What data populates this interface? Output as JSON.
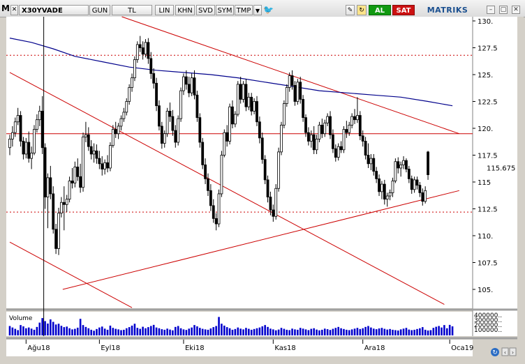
{
  "toolbar": {
    "menu_letter": "M",
    "symbol": "X30YVADE",
    "period": "GUN",
    "currency": "TL",
    "scale_buttons": [
      "LIN",
      "KHN",
      "SVD",
      "SYM",
      "TMP"
    ],
    "buy_label": "AL",
    "sell_label": "SAT",
    "brand": "MATRIKS",
    "brand_color": "#1a4f8f",
    "buy_color": "#119911",
    "sell_color": "#cc1111"
  },
  "chart_data": [
    {
      "type": "candlestick",
      "ylim": [
        103.3,
        130.5
      ],
      "yticks": [
        105,
        107.5,
        110,
        112.5,
        115,
        117.5,
        120,
        122.5,
        125,
        127.5,
        130
      ],
      "ytick_labels": [
        "105.",
        "107.5",
        "110.",
        "112.5",
        "115",
        "117.5",
        "120.",
        "122.5",
        "125.",
        "127.5",
        "130."
      ],
      "last_price_label": "115.675",
      "last_price": 115.675,
      "x_tick_labels": [
        "Ağu18",
        "Eyl18",
        "Eki18",
        "Kas18",
        "Ara18",
        "Oca19"
      ],
      "x_tick_index": [
        6,
        33,
        64,
        97,
        130,
        162
      ],
      "grid": false,
      "moving_average_color": "#00008b",
      "up_color": "#ffffff",
      "down_color": "#000000",
      "candles": [
        [
          118.2,
          119.4,
          117.5,
          119.0
        ],
        [
          119.0,
          120.2,
          118.3,
          119.6
        ],
        [
          119.6,
          121.0,
          119.2,
          120.6
        ],
        [
          120.6,
          121.9,
          120.3,
          121.2
        ],
        [
          121.2,
          121.6,
          118.3,
          118.8
        ],
        [
          118.8,
          119.2,
          117.1,
          117.6
        ],
        [
          117.6,
          119.1,
          117.2,
          118.7
        ],
        [
          118.7,
          119.7,
          116.8,
          117.2
        ],
        [
          117.2,
          118.3,
          116.2,
          117.7
        ],
        [
          117.7,
          120.3,
          117.5,
          119.9
        ],
        [
          119.9,
          121.3,
          119.6,
          120.8
        ],
        [
          120.8,
          122.1,
          120.2,
          121.6
        ],
        [
          121.6,
          123.0,
          117.6,
          118.2
        ],
        [
          118.2,
          118.6,
          112.5,
          113.6
        ],
        [
          113.6,
          115.8,
          110.7,
          115.4
        ],
        [
          115.4,
          116.5,
          113.4,
          113.9
        ],
        [
          113.9,
          114.6,
          110.2,
          110.6
        ],
        [
          110.6,
          111.1,
          108.3,
          108.8
        ],
        [
          108.8,
          112.6,
          108.2,
          112.1
        ],
        [
          112.1,
          113.6,
          111.7,
          113.1
        ],
        [
          113.1,
          114.6,
          110.5,
          112.9
        ],
        [
          112.9,
          113.8,
          112.2,
          113.4
        ],
        [
          113.4,
          115.5,
          113.1,
          115.1
        ],
        [
          115.1,
          116.3,
          114.4,
          114.9
        ],
        [
          114.9,
          116.9,
          114.5,
          116.4
        ],
        [
          116.4,
          117.2,
          115.1,
          115.5
        ],
        [
          115.5,
          116.7,
          114.0,
          114.5
        ],
        [
          114.5,
          119.6,
          114.1,
          119.2
        ],
        [
          119.2,
          120.6,
          118.7,
          119.4
        ],
        [
          119.4,
          120.1,
          117.9,
          118.3
        ],
        [
          118.3,
          118.9,
          117.1,
          117.6
        ],
        [
          117.6,
          118.6,
          116.8,
          117.9
        ],
        [
          117.9,
          118.5,
          116.7,
          117.2
        ],
        [
          117.2,
          117.9,
          116.2,
          116.7
        ],
        [
          116.7,
          117.4,
          115.6,
          116.2
        ],
        [
          116.2,
          117.1,
          115.7,
          116.8
        ],
        [
          116.8,
          117.5,
          115.9,
          116.3
        ],
        [
          116.3,
          118.7,
          116.0,
          118.4
        ],
        [
          118.4,
          120.3,
          118.2,
          119.9
        ],
        [
          119.9,
          120.6,
          119.1,
          119.5
        ],
        [
          119.5,
          120.5,
          119.0,
          120.2
        ],
        [
          120.2,
          121.2,
          119.8,
          120.9
        ],
        [
          120.9,
          121.9,
          120.6,
          121.5
        ],
        [
          121.5,
          122.8,
          121.2,
          122.5
        ],
        [
          122.5,
          124.1,
          122.2,
          123.8
        ],
        [
          123.8,
          125.1,
          123.4,
          124.7
        ],
        [
          124.7,
          126.7,
          124.4,
          126.4
        ],
        [
          126.4,
          128.1,
          126.1,
          127.8
        ],
        [
          127.8,
          128.6,
          127.1,
          127.5
        ],
        [
          127.5,
          128.1,
          126.4,
          126.9
        ],
        [
          126.9,
          128.3,
          126.6,
          128.0
        ],
        [
          128.0,
          128.4,
          126.0,
          126.5
        ],
        [
          126.5,
          127.1,
          124.6,
          125.1
        ],
        [
          125.1,
          125.6,
          123.7,
          124.2
        ],
        [
          124.2,
          124.7,
          121.6,
          122.1
        ],
        [
          122.1,
          122.6,
          119.8,
          120.2
        ],
        [
          120.2,
          120.6,
          118.1,
          118.6
        ],
        [
          118.6,
          119.8,
          118.2,
          119.5
        ],
        [
          119.5,
          121.9,
          119.2,
          121.6
        ],
        [
          121.6,
          122.4,
          120.6,
          121.1
        ],
        [
          121.1,
          121.7,
          119.3,
          119.8
        ],
        [
          119.8,
          120.3,
          118.2,
          118.7
        ],
        [
          118.7,
          121.2,
          118.4,
          120.9
        ],
        [
          120.9,
          123.8,
          120.6,
          123.5
        ],
        [
          123.5,
          125.1,
          123.1,
          124.8
        ],
        [
          124.8,
          125.4,
          123.6,
          124.1
        ],
        [
          124.1,
          124.8,
          122.9,
          123.3
        ],
        [
          123.3,
          125.1,
          123.0,
          124.7
        ],
        [
          124.7,
          125.4,
          122.7,
          123.1
        ],
        [
          123.1,
          123.5,
          120.6,
          121.0
        ],
        [
          121.0,
          121.4,
          118.2,
          118.7
        ],
        [
          118.7,
          119.1,
          116.2,
          116.6
        ],
        [
          116.6,
          117.2,
          114.8,
          115.3
        ],
        [
          115.3,
          115.8,
          113.7,
          114.2
        ],
        [
          114.2,
          114.8,
          112.3,
          112.8
        ],
        [
          112.8,
          113.4,
          111.2,
          111.6
        ],
        [
          111.6,
          112.1,
          110.5,
          111.1
        ],
        [
          111.1,
          114.3,
          110.8,
          113.9
        ],
        [
          113.9,
          117.9,
          113.6,
          117.5
        ],
        [
          117.5,
          119.9,
          117.3,
          119.6
        ],
        [
          119.6,
          120.3,
          118.3,
          118.8
        ],
        [
          118.8,
          122.3,
          118.5,
          122.0
        ],
        [
          122.0,
          122.6,
          120.0,
          120.4
        ],
        [
          120.4,
          121.6,
          120.1,
          121.3
        ],
        [
          121.3,
          124.4,
          121.1,
          124.1
        ],
        [
          124.1,
          124.8,
          122.3,
          122.7
        ],
        [
          122.7,
          124.4,
          122.4,
          124.1
        ],
        [
          124.1,
          124.6,
          121.6,
          122.0
        ],
        [
          122.0,
          123.3,
          121.7,
          122.9
        ],
        [
          122.9,
          123.3,
          121.2,
          121.6
        ],
        [
          121.6,
          122.8,
          121.3,
          122.5
        ],
        [
          122.5,
          123.0,
          120.2,
          120.6
        ],
        [
          120.6,
          121.1,
          118.6,
          119.1
        ],
        [
          119.1,
          119.6,
          116.7,
          117.1
        ],
        [
          117.1,
          117.5,
          114.8,
          115.2
        ],
        [
          115.2,
          115.6,
          113.1,
          113.6
        ],
        [
          113.6,
          114.1,
          111.9,
          112.4
        ],
        [
          112.4,
          112.9,
          111.3,
          111.8
        ],
        [
          111.8,
          114.8,
          111.5,
          114.4
        ],
        [
          114.4,
          118.2,
          114.1,
          117.8
        ],
        [
          117.8,
          120.6,
          117.5,
          120.3
        ],
        [
          120.3,
          122.6,
          120.0,
          122.3
        ],
        [
          122.3,
          124.1,
          122.0,
          123.8
        ],
        [
          123.8,
          125.2,
          123.4,
          124.9
        ],
        [
          124.9,
          125.4,
          123.6,
          124.0
        ],
        [
          124.0,
          124.4,
          122.1,
          122.5
        ],
        [
          122.5,
          124.6,
          122.2,
          124.3
        ],
        [
          124.3,
          124.8,
          122.3,
          122.7
        ],
        [
          122.7,
          123.1,
          120.6,
          121.0
        ],
        [
          121.0,
          121.3,
          119.2,
          119.6
        ],
        [
          119.6,
          120.1,
          118.4,
          118.8
        ],
        [
          118.8,
          119.8,
          118.2,
          119.4
        ],
        [
          119.4,
          120.2,
          117.6,
          118.0
        ],
        [
          118.0,
          119.4,
          117.6,
          119.0
        ],
        [
          119.0,
          120.6,
          118.7,
          120.3
        ],
        [
          120.3,
          120.9,
          119.1,
          119.5
        ],
        [
          119.5,
          120.8,
          119.2,
          120.5
        ],
        [
          120.5,
          121.4,
          120.2,
          121.1
        ],
        [
          121.1,
          121.6,
          119.0,
          119.4
        ],
        [
          119.4,
          119.9,
          117.7,
          118.1
        ],
        [
          118.1,
          118.5,
          116.9,
          117.3
        ],
        [
          117.3,
          118.6,
          117.0,
          118.3
        ],
        [
          118.3,
          118.8,
          117.7,
          118.0
        ],
        [
          118.0,
          120.2,
          117.7,
          119.9
        ],
        [
          119.9,
          120.7,
          119.1,
          119.6
        ],
        [
          119.6,
          120.6,
          119.3,
          120.3
        ],
        [
          120.3,
          121.4,
          120.0,
          121.1
        ],
        [
          121.1,
          121.8,
          120.4,
          120.8
        ],
        [
          120.8,
          122.9,
          120.5,
          121.2
        ],
        [
          121.2,
          121.6,
          118.9,
          119.3
        ],
        [
          119.3,
          119.8,
          118.3,
          118.8
        ],
        [
          118.8,
          119.2,
          117.1,
          117.5
        ],
        [
          117.5,
          118.6,
          116.3,
          116.7
        ],
        [
          116.7,
          117.6,
          116.1,
          117.2
        ],
        [
          117.2,
          117.6,
          115.6,
          116.0
        ],
        [
          116.0,
          116.4,
          114.9,
          115.3
        ],
        [
          115.3,
          115.7,
          113.7,
          114.1
        ],
        [
          114.1,
          115.1,
          113.4,
          114.8
        ],
        [
          114.8,
          115.2,
          112.9,
          113.4
        ],
        [
          113.4,
          114.0,
          112.7,
          113.7
        ],
        [
          113.7,
          114.3,
          113.3,
          114.0
        ],
        [
          114.0,
          115.4,
          113.6,
          115.1
        ],
        [
          115.1,
          117.2,
          114.9,
          116.9
        ],
        [
          116.9,
          117.3,
          115.8,
          116.3
        ],
        [
          116.3,
          116.9,
          115.5,
          116.6
        ],
        [
          116.6,
          117.4,
          116.2,
          117.0
        ],
        [
          117.0,
          117.2,
          115.9,
          116.2
        ],
        [
          116.2,
          116.5,
          114.9,
          115.3
        ],
        [
          115.3,
          115.6,
          113.9,
          114.3
        ],
        [
          114.3,
          115.5,
          114.0,
          115.2
        ],
        [
          115.2,
          115.5,
          114.3,
          114.7
        ],
        [
          114.7,
          115.0,
          113.6,
          114.0
        ],
        [
          114.0,
          114.4,
          112.8,
          113.2
        ],
        [
          113.2,
          114.6,
          113.0,
          114.2
        ],
        [
          117.8,
          117.9,
          115.2,
          115.675
        ]
      ],
      "moving_average": [
        [
          0,
          128.4
        ],
        [
          8,
          128.0
        ],
        [
          16,
          127.4
        ],
        [
          24,
          126.7
        ],
        [
          34,
          126.2
        ],
        [
          44,
          125.7
        ],
        [
          54,
          125.4
        ],
        [
          64,
          125.2
        ],
        [
          74,
          125.0
        ],
        [
          84,
          124.7
        ],
        [
          94,
          124.3
        ],
        [
          104,
          123.9
        ],
        [
          114,
          123.5
        ],
        [
          124,
          123.3
        ],
        [
          134,
          123.1
        ],
        [
          144,
          122.9
        ],
        [
          154,
          122.5
        ],
        [
          163,
          122.1
        ]
      ],
      "horizontal_lines": [
        {
          "value": 126.8,
          "style": "dashed",
          "color": "#cc0000"
        },
        {
          "value": 119.5,
          "style": "solid",
          "color": "#cc0000"
        },
        {
          "value": 112.2,
          "style": "dashed",
          "color": "#cc0000"
        }
      ],
      "trend_lines": [
        {
          "from": [
            19.5,
            105.0
          ],
          "to": [
            165.5,
            114.2
          ],
          "color": "#cc0000"
        },
        {
          "from": [
            0,
            125.2
          ],
          "to": [
            160,
            103.6
          ],
          "color": "#cc0000"
        },
        {
          "from": [
            0,
            109.4
          ],
          "to": [
            45,
            103.3
          ],
          "color": "#cc0000"
        },
        {
          "from": [
            40,
            130.5
          ],
          "to": [
            165.5,
            119.5
          ],
          "color": "#cc0000"
        }
      ],
      "cursor_index": 12.5
    },
    {
      "type": "bar",
      "title": "Volume",
      "ytick_labels": [
        "400000..",
        "300000..",
        "200000..",
        "100000.."
      ],
      "bar_color": "#0000cc",
      "values": [
        0.5,
        0.42,
        0.35,
        0.28,
        0.55,
        0.48,
        0.38,
        0.42,
        0.36,
        0.3,
        0.45,
        0.68,
        0.92,
        0.76,
        0.63,
        0.85,
        0.72,
        0.58,
        0.62,
        0.51,
        0.44,
        0.47,
        0.38,
        0.32,
        0.35,
        0.41,
        0.88,
        0.55,
        0.45,
        0.38,
        0.3,
        0.25,
        0.34,
        0.42,
        0.47,
        0.36,
        0.3,
        0.52,
        0.4,
        0.35,
        0.32,
        0.28,
        0.3,
        0.38,
        0.44,
        0.52,
        0.62,
        0.4,
        0.35,
        0.46,
        0.38,
        0.44,
        0.5,
        0.56,
        0.42,
        0.38,
        0.33,
        0.3,
        0.36,
        0.31,
        0.27,
        0.45,
        0.5,
        0.38,
        0.32,
        0.29,
        0.36,
        0.42,
        0.55,
        0.48,
        0.4,
        0.35,
        0.32,
        0.3,
        0.37,
        0.44,
        0.5,
        0.98,
        0.62,
        0.52,
        0.44,
        0.38,
        0.3,
        0.34,
        0.42,
        0.36,
        0.32,
        0.4,
        0.35,
        0.3,
        0.34,
        0.38,
        0.42,
        0.48,
        0.55,
        0.45,
        0.36,
        0.32,
        0.27,
        0.31,
        0.4,
        0.35,
        0.3,
        0.28,
        0.36,
        0.32,
        0.3,
        0.4,
        0.36,
        0.32,
        0.28,
        0.35,
        0.38,
        0.31,
        0.27,
        0.3,
        0.36,
        0.33,
        0.29,
        0.35,
        0.4,
        0.45,
        0.38,
        0.34,
        0.3,
        0.28,
        0.32,
        0.36,
        0.4,
        0.34,
        0.38,
        0.45,
        0.5,
        0.42,
        0.36,
        0.33,
        0.37,
        0.4,
        0.35,
        0.31,
        0.34,
        0.3,
        0.28,
        0.26,
        0.32,
        0.36,
        0.4,
        0.31,
        0.28,
        0.3,
        0.34,
        0.38,
        0.44,
        0.3,
        0.26,
        0.28,
        0.4,
        0.46,
        0.5,
        0.42,
        0.55,
        0.38,
        0.56,
        0.48
      ]
    }
  ]
}
